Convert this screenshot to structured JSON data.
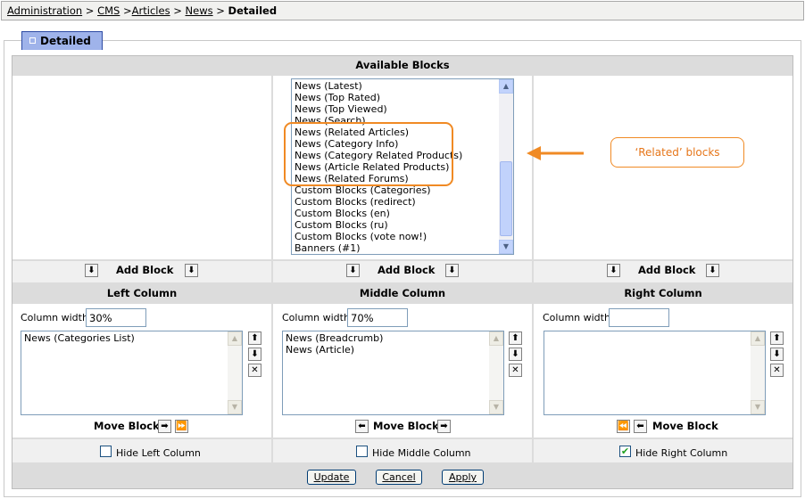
{
  "breadcrumb": {
    "items": [
      "Administration",
      "CMS",
      "Articles",
      "News"
    ],
    "seps": [
      " > ",
      " >",
      " > ",
      " > "
    ],
    "current": "Detailed"
  },
  "tab": {
    "label": "Detailed"
  },
  "available": {
    "header": "Available Blocks",
    "items": [
      "News (Latest)",
      "News (Top Rated)",
      "News (Top Viewed)",
      "News (Search)",
      "News (Related Articles)",
      "News (Category Info)",
      "News (Category Related Products)",
      "News (Article Related Products)",
      "News (Related Forums)",
      "Custom Blocks (Categories)",
      "Custom Blocks (redirect)",
      "Custom Blocks (en)",
      "Custom Blocks (ru)",
      "Custom Blocks (vote now!)",
      "Banners (#1)"
    ]
  },
  "callout": {
    "label": "‘Related’ blocks"
  },
  "add_block": {
    "label": "Add Block"
  },
  "columns": {
    "left": {
      "header": "Left Column",
      "width_label": "Column width",
      "width_value": "30%",
      "items": [
        "News (Categories List)"
      ],
      "move_label": "Move Block",
      "hide_label": "Hide Left Column",
      "hide_checked": false
    },
    "middle": {
      "header": "Middle Column",
      "width_label": "Column width",
      "width_value": "70%",
      "items": [
        "News (Breadcrumb)",
        "News (Article)"
      ],
      "move_label": "Move Block",
      "hide_label": "Hide Middle Column",
      "hide_checked": false
    },
    "right": {
      "header": "Right Column",
      "width_label": "Column width",
      "width_value": "",
      "items": [],
      "move_label": "Move Block",
      "hide_label": "Hide Right Column",
      "hide_checked": true
    }
  },
  "buttons": {
    "update": "Update",
    "cancel": "Cancel",
    "apply": "Apply"
  },
  "icons": {
    "arrow_down": "⬇",
    "arrow_up": "⬆",
    "arrow_right": "➡",
    "arrow_left": "⬅",
    "double_right": "⏩",
    "double_left": "⏪",
    "delete": "✕",
    "check": "✔"
  },
  "colors": {
    "accent": "#f08a24",
    "tab": "#9fb3ea",
    "panel": "#dcdcdc"
  }
}
